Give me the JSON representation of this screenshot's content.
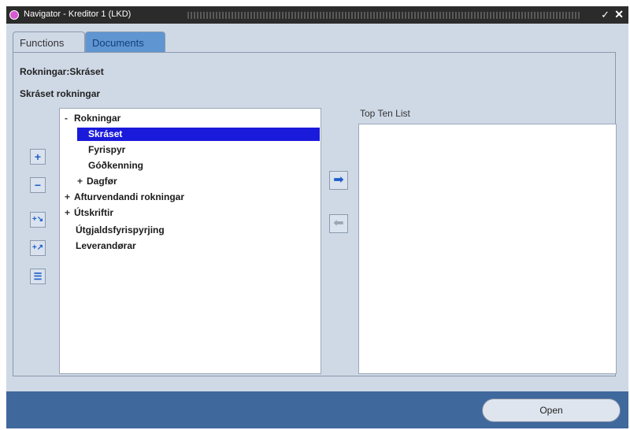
{
  "window": {
    "title": "Navigator - Kreditor 1 (LKD)",
    "minimize_glyph": "✓",
    "close_glyph": "✕"
  },
  "tabs": [
    {
      "label": "Functions",
      "selected": true
    },
    {
      "label": "Documents",
      "selected": false
    }
  ],
  "breadcrumb": "Rokningar:Skráset",
  "list_title": "Skráset rokningar",
  "tree": [
    {
      "label": "Rokningar",
      "expander": "-"
    },
    {
      "label": "Skráset",
      "expander": ""
    },
    {
      "label": "Fyrispyr",
      "expander": ""
    },
    {
      "label": "Góðkenning",
      "expander": ""
    },
    {
      "label": "Dagfør",
      "expander": "+"
    },
    {
      "label": "Afturvendandi rokningar",
      "expander": "+"
    },
    {
      "label": "Útskriftir",
      "expander": "+"
    },
    {
      "label": "Útgjaldsfyrispyrjing",
      "expander": ""
    },
    {
      "label": "Leverandørar",
      "expander": ""
    }
  ],
  "side_buttons": [
    {
      "icon": "expand-icon",
      "glyph": "+"
    },
    {
      "icon": "collapse-icon",
      "glyph": "−"
    },
    {
      "icon": "expand-all-icon",
      "glyph": "+↘"
    },
    {
      "icon": "collapse-all-icon",
      "glyph": "+↗"
    },
    {
      "icon": "collapse-branch-icon",
      "glyph": "☰"
    }
  ],
  "move_buttons": {
    "right_glyph": "➡",
    "left_glyph": "⬅"
  },
  "top_ten": {
    "label": "Top Ten List"
  },
  "open_button": {
    "label": "Open"
  },
  "colors": {
    "window_bg": "#cfd9e6",
    "selection": "#1a1adb",
    "footer": "#3f689d",
    "tab_inactive": "#5f95d1"
  }
}
